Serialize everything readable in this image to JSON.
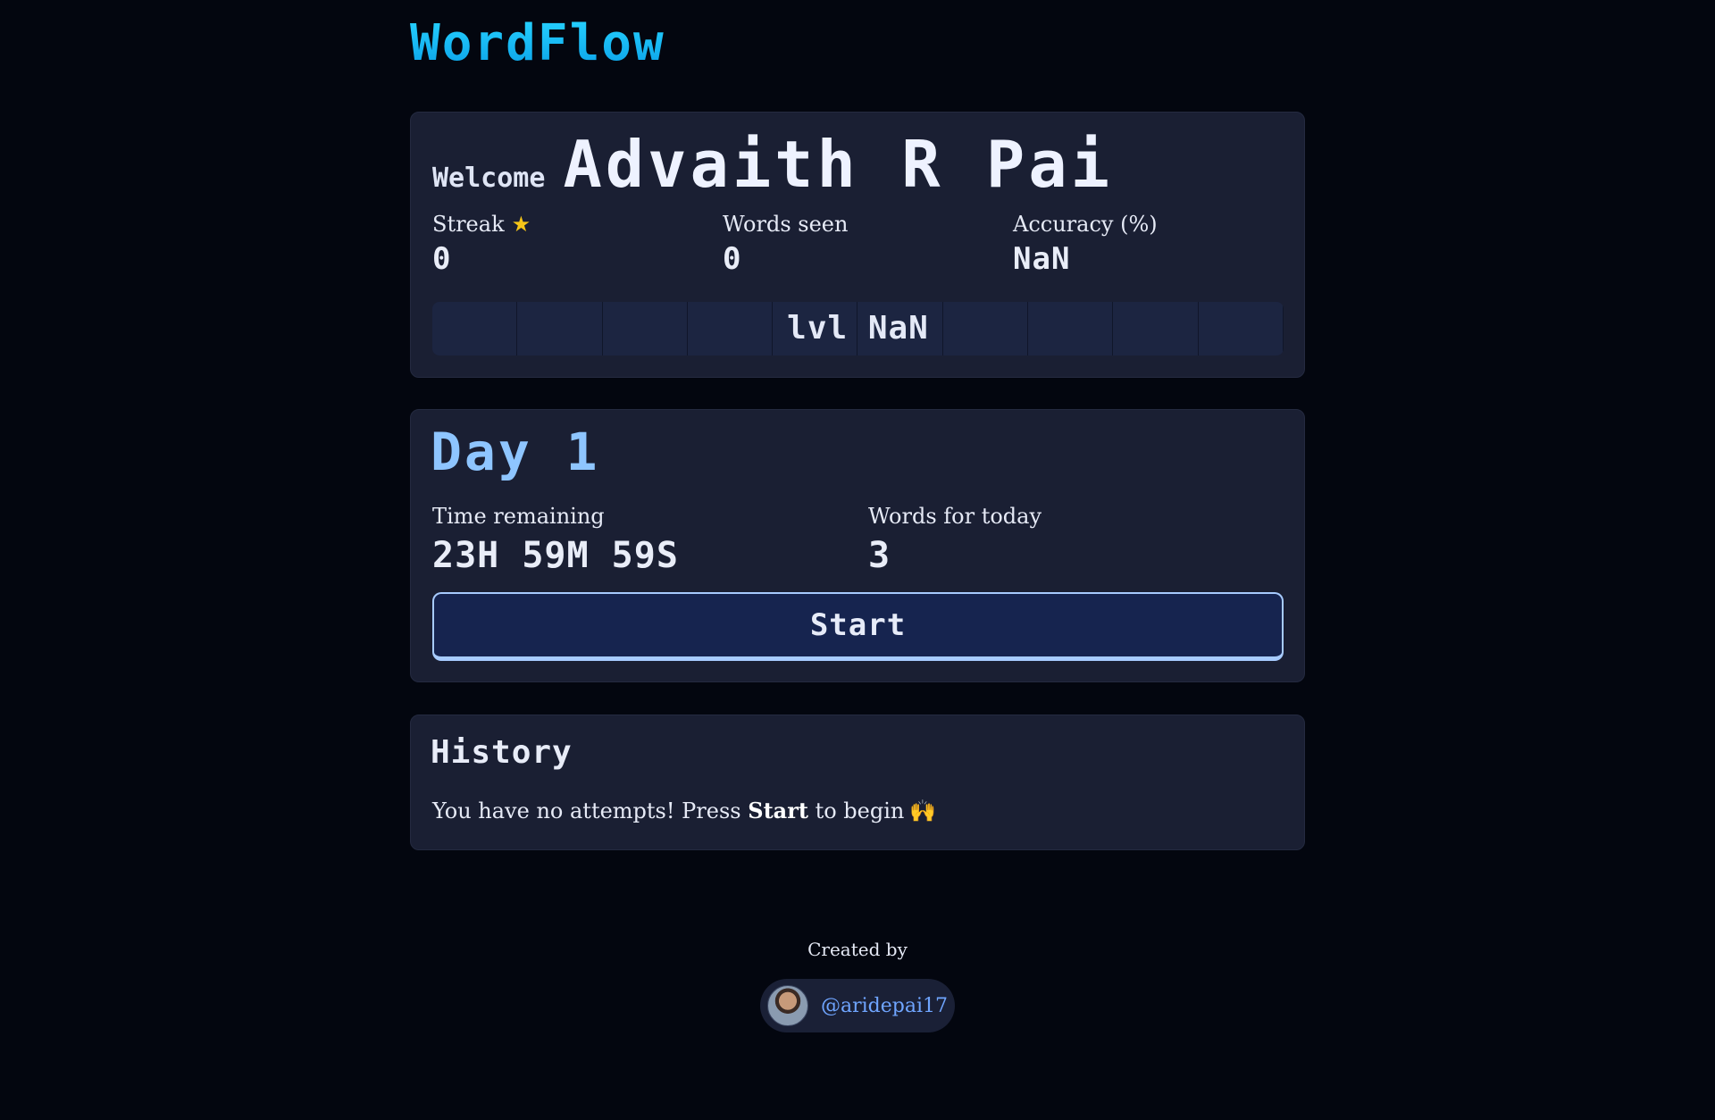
{
  "app": {
    "title": "WordFlow"
  },
  "welcome": {
    "label": "Welcome",
    "name": "Advaith R Pai",
    "stats": [
      {
        "label": "Streak",
        "value": "0",
        "icon": "star-icon"
      },
      {
        "label": "Words seen",
        "value": "0"
      },
      {
        "label": "Accuracy (%)",
        "value": "NaN"
      }
    ],
    "level": {
      "text": "lvl NaN",
      "segments": 10
    }
  },
  "day": {
    "title": "Day 1",
    "time_remaining_label": "Time remaining",
    "time_remaining_value": "23H 59M 59S",
    "words_today_label": "Words for today",
    "words_today_value": "3",
    "start_label": "Start"
  },
  "history": {
    "title": "History",
    "message_before": "You have no attempts! Press ",
    "message_bold": "Start",
    "message_after": " to begin",
    "message_icon": "raising-hands-icon"
  },
  "footer": {
    "created_by": "Created by",
    "handle": "@aridepai17"
  },
  "colors": {
    "background": "#03060f",
    "card": "#1a1f33",
    "accent_blue": "#8ec5ff",
    "logo_cyan": "#14b8f5",
    "button_bg": "#16244f",
    "button_border": "#a7cbff",
    "link": "#6fa5ff"
  }
}
